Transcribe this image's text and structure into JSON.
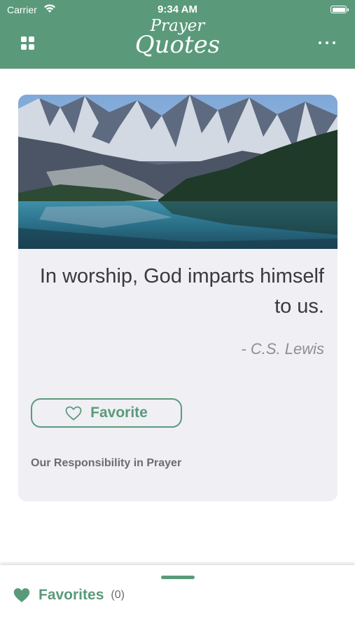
{
  "status_bar": {
    "carrier": "Carrier",
    "time": "9:34 AM"
  },
  "header": {
    "title_line1": "Prayer",
    "title_line2": "Quotes",
    "left_icon": "grid-icon",
    "right_icon": "more-icon"
  },
  "quote_card": {
    "image": "mountain-lake-photo",
    "quote": "In worship, God imparts himself to us.",
    "author": "- C.S. Lewis",
    "favorite_label": "Favorite",
    "category": "Our Responsibility in Prayer"
  },
  "bottom_drawer": {
    "favorites_label": "Favorites",
    "favorites_count": "(0)"
  },
  "colors": {
    "accent": "#5a9a7a",
    "card_bg": "#efeff4",
    "text": "#3a3a3a",
    "muted": "#8e8e93"
  }
}
